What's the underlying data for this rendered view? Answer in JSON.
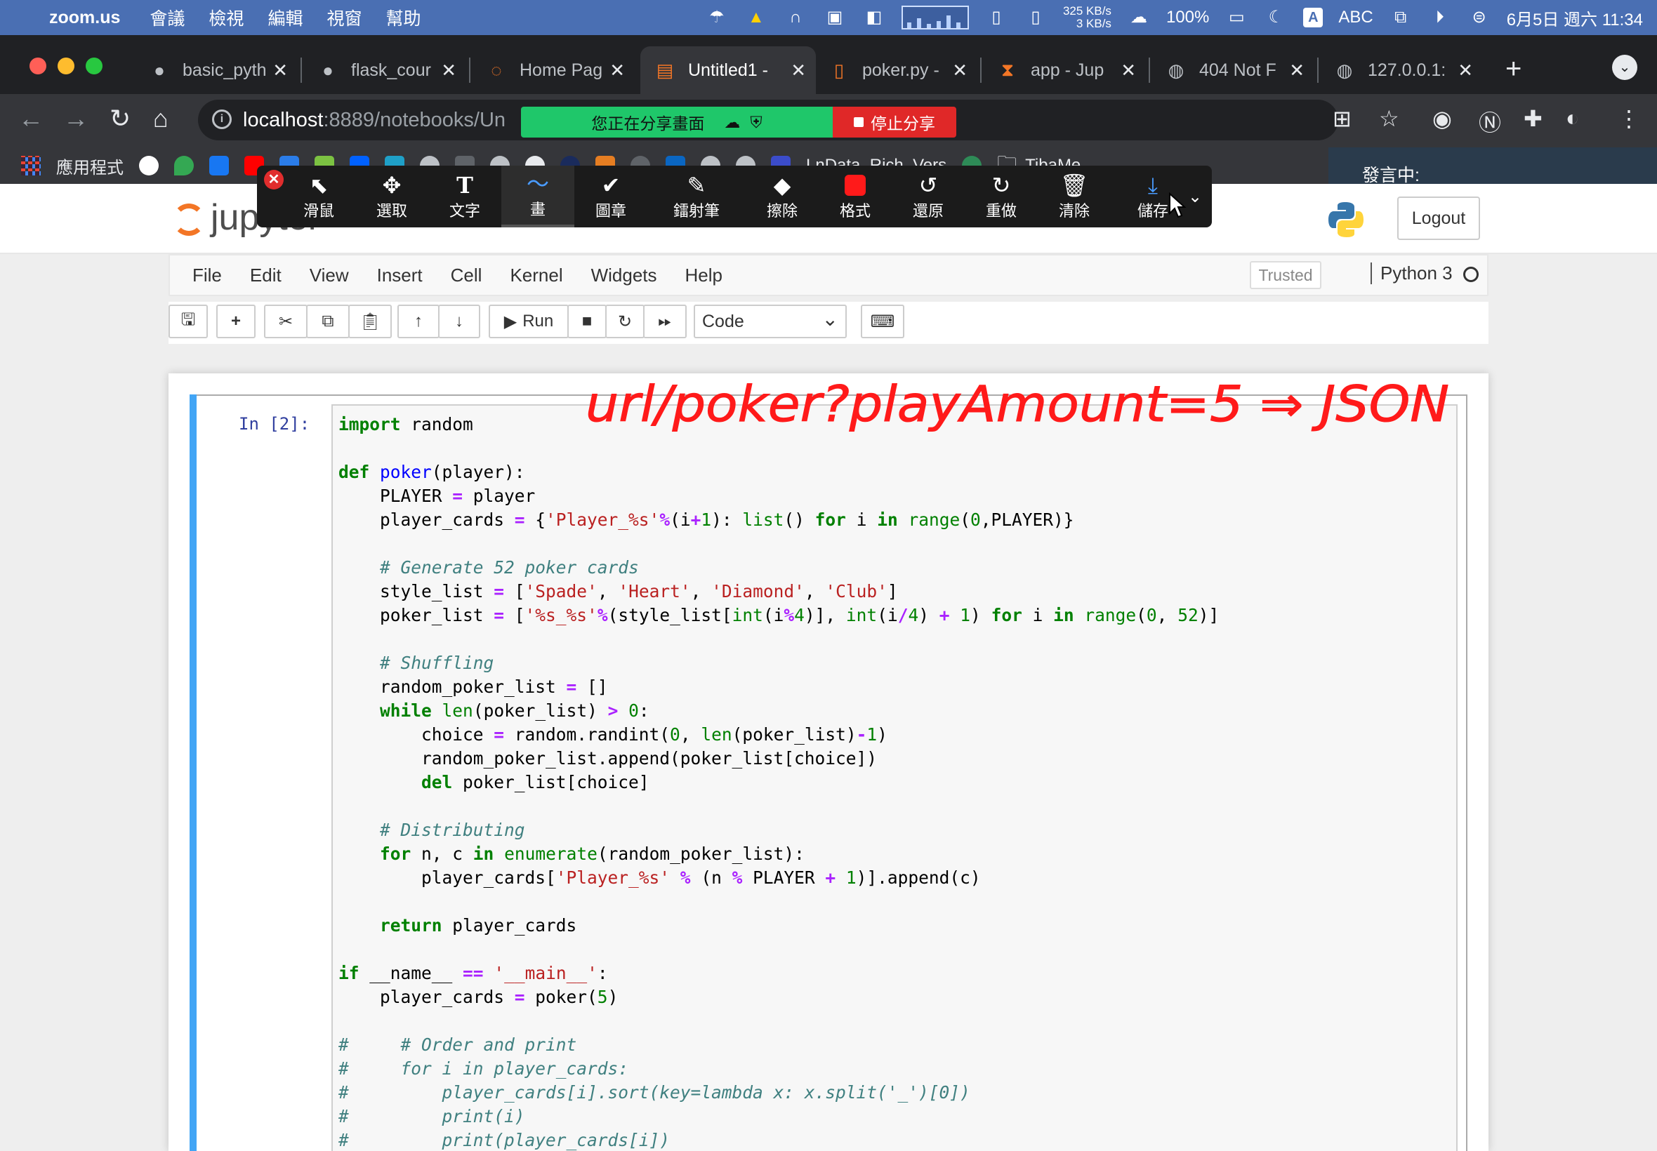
{
  "macos": {
    "app_name": "zoom.us",
    "menu_items": [
      "會議",
      "檢視",
      "編輯",
      "視窗",
      "幫助"
    ],
    "net_up": "325 KB/s",
    "net_down": "3 KB/s",
    "battery": "100%",
    "input_source": "ABC",
    "datetime": "6月5日 週六 11:34"
  },
  "browser": {
    "tabs": [
      {
        "label": "basic_pyth",
        "icon": "github-icon"
      },
      {
        "label": "flask_cour",
        "icon": "github-icon"
      },
      {
        "label": "Home Pag",
        "icon": "jupyter-icon"
      },
      {
        "label": "Untitled1 -",
        "icon": "notebook-icon",
        "active": true
      },
      {
        "label": "poker.py -",
        "icon": "file-icon"
      },
      {
        "label": "app - Jup",
        "icon": "hourglass-icon"
      },
      {
        "label": "404 Not F",
        "icon": "globe-icon"
      },
      {
        "label": "127.0.0.1:",
        "icon": "globe-icon"
      }
    ],
    "url_host": "localhost",
    "url_path": ":8889/notebooks/Un",
    "bookmarks_apps": "應用程式",
    "bookmark_lndata": "LnData_Rich_Vers",
    "bookmark_folder": "TibaMe"
  },
  "zoom": {
    "sharing_label": "您正在分享畫面",
    "stop_label": "停止分享",
    "speaking_label": "發言中:",
    "tools": [
      {
        "label": "滑鼠",
        "icon": "pointer-icon",
        "glyph": "⬉"
      },
      {
        "label": "選取",
        "icon": "move-icon",
        "glyph": "✥"
      },
      {
        "label": "文字",
        "icon": "text-icon",
        "glyph": "T"
      },
      {
        "label": "畫",
        "icon": "draw-icon",
        "glyph": "〜"
      },
      {
        "label": "圖章",
        "icon": "stamp-icon",
        "glyph": "✔"
      },
      {
        "label": "鐳射筆",
        "icon": "laser-icon",
        "glyph": "✎"
      },
      {
        "label": "擦除",
        "icon": "eraser-icon",
        "glyph": "◆"
      },
      {
        "label": "格式",
        "icon": "format-icon",
        "glyph": ""
      },
      {
        "label": "還原",
        "icon": "undo-icon",
        "glyph": "↺"
      },
      {
        "label": "重做",
        "icon": "redo-icon",
        "glyph": "↻"
      },
      {
        "label": "清除",
        "icon": "trash-icon",
        "glyph": "🗑"
      },
      {
        "label": "儲存",
        "icon": "save-icon",
        "glyph": "⤓"
      }
    ],
    "annotation_text": "url/poker?playAmount=5 ⇒ JSON",
    "annotation_color": "#ff1a1a"
  },
  "jupyter": {
    "logo_text": "jupyter",
    "logout": "Logout",
    "menu": [
      "File",
      "Edit",
      "View",
      "Insert",
      "Cell",
      "Kernel",
      "Widgets",
      "Help"
    ],
    "trusted": "Trusted",
    "kernel": "Python 3",
    "run_label": "Run",
    "cell_type": "Code",
    "prompt": "In [2]:"
  }
}
